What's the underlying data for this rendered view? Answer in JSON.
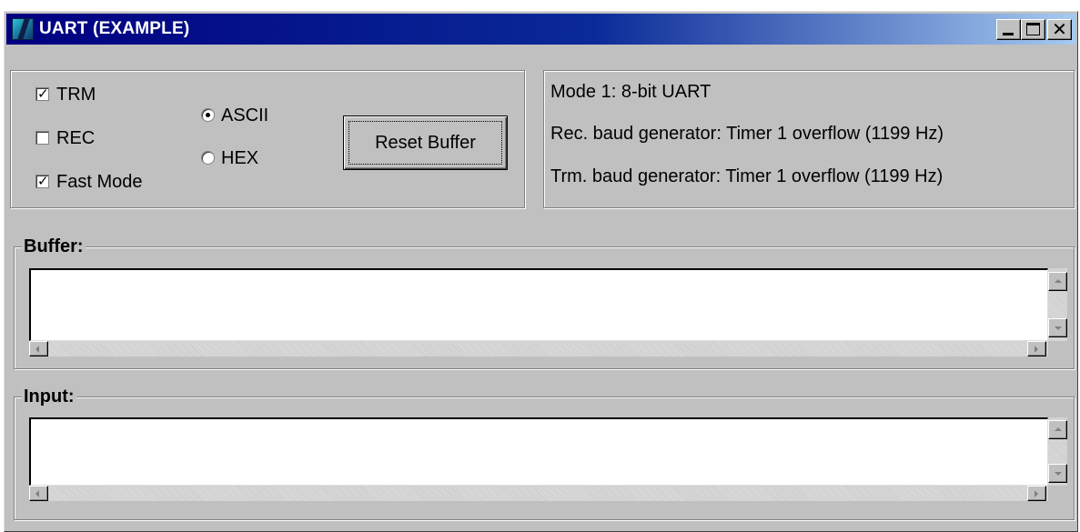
{
  "window": {
    "title": "UART (EXAMPLE)",
    "app_icon": "uart-app-icon",
    "controls": {
      "minimize": "minimize-icon",
      "maximize": "maximize-icon",
      "close": "✕"
    }
  },
  "options": {
    "trm": {
      "label": "TRM",
      "checked": true
    },
    "rec": {
      "label": "REC",
      "checked": false
    },
    "fast_mode": {
      "label": "Fast Mode",
      "checked": true
    },
    "format": {
      "ascii": {
        "label": "ASCII",
        "selected": true
      },
      "hex": {
        "label": "HEX",
        "selected": false
      }
    },
    "reset_buffer_label": "Reset Buffer"
  },
  "info": {
    "mode": "Mode 1: 8-bit UART",
    "rec_baud": "Rec. baud generator: Timer 1 overflow (1199 Hz)",
    "trm_baud": "Trm. baud generator: Timer 1 overflow (1199 Hz)"
  },
  "buffer": {
    "label": "Buffer:",
    "value": ""
  },
  "input": {
    "label": "Input:",
    "value": ""
  },
  "colors": {
    "face": "#c0c0c0",
    "title_start": "#000080",
    "title_end": "#a6caf0"
  }
}
